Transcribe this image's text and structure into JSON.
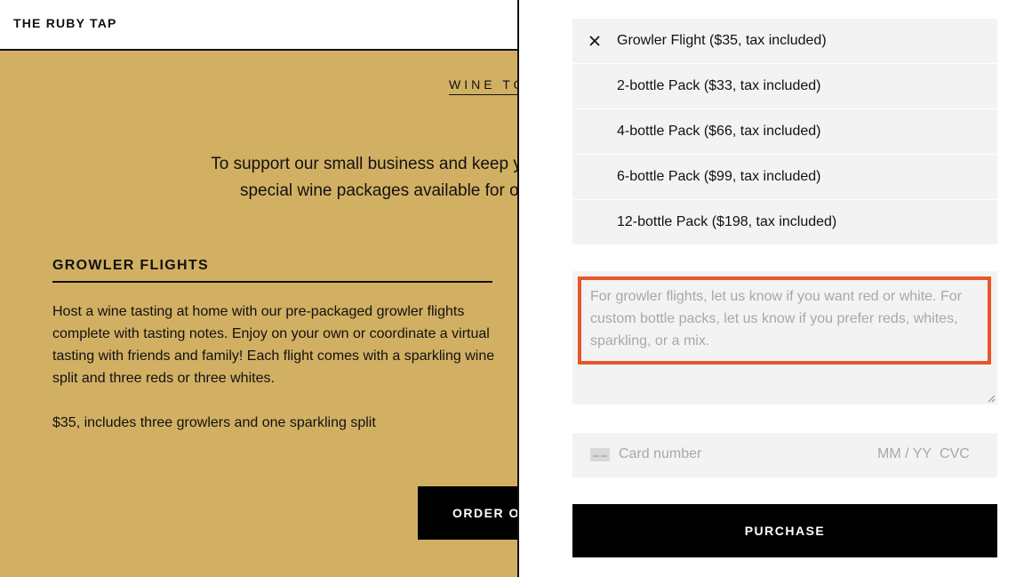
{
  "site": {
    "brand": "THE RUBY TAP",
    "section_kicker": "WINE TO",
    "intro_line1": "To support our small business and keep you c",
    "intro_line2": "special wine packages available for or",
    "growler": {
      "heading": "GROWLER FLIGHTS",
      "description": "Host a wine tasting at home with our pre-packaged growler flights complete with tasting notes. Enjoy on your own or coordinate a virtual tasting with friends and family! Each flight comes with a sparkling wine split and three reds or three whites.",
      "price_note": "$35, includes three growlers and one sparkling split",
      "order_label": "ORDER ON"
    }
  },
  "drawer": {
    "options": [
      {
        "label": "Growler Flight ($35, tax included)",
        "selected": true,
        "icon": "close-icon"
      },
      {
        "label": "2-bottle Pack ($33, tax included)",
        "selected": false
      },
      {
        "label": "4-bottle Pack ($66, tax included)",
        "selected": false
      },
      {
        "label": "6-bottle Pack ($99, tax included)",
        "selected": false
      },
      {
        "label": "12-bottle Pack ($198, tax included)",
        "selected": false
      }
    ],
    "notes_placeholder": "For growler flights, let us know if you want red or white. For custom bottle packs, let us know if you prefer reds, whites, sparkling, or a mix.",
    "notes_focus_color": "#e8572a",
    "card": {
      "icon": "credit-card-icon",
      "number_placeholder": "Card number",
      "expiry_placeholder": "MM / YY",
      "cvc_placeholder": "CVC"
    },
    "purchase_label": "PURCHASE"
  },
  "colors": {
    "page_background": "#d2b063",
    "field_background": "#f3f3f3",
    "button_background": "#000000"
  }
}
